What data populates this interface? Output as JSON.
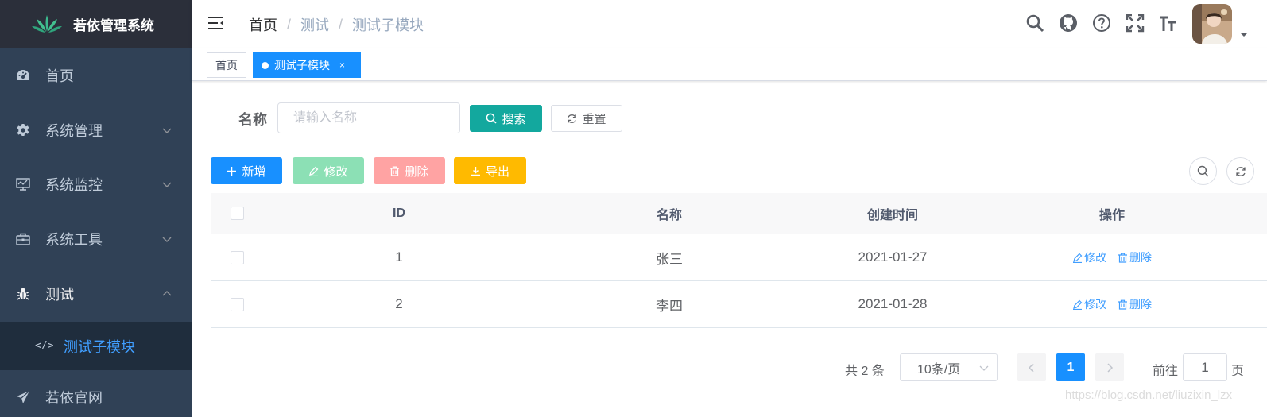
{
  "app": {
    "title": "若依管理系统"
  },
  "sidebar": {
    "items": [
      {
        "label": "首页",
        "icon": "dashboard-icon"
      },
      {
        "label": "系统管理",
        "icon": "gear-icon"
      },
      {
        "label": "系统监控",
        "icon": "monitor-icon"
      },
      {
        "label": "系统工具",
        "icon": "toolbox-icon"
      },
      {
        "label": "测试",
        "icon": "bug-icon"
      },
      {
        "label": "若依官网",
        "icon": "send-icon"
      }
    ],
    "submenu": {
      "label": "测试子模块",
      "icon": "code-icon"
    }
  },
  "breadcrumb": [
    "首页",
    "测试",
    "测试子模块"
  ],
  "tags": [
    {
      "label": "首页"
    },
    {
      "label": "测试子模块",
      "close": "×"
    }
  ],
  "search": {
    "label": "名称",
    "placeholder": "请输入名称",
    "search_btn": "搜索",
    "reset_btn": "重置"
  },
  "toolbar": {
    "add": "新增",
    "edit": "修改",
    "delete": "删除",
    "export": "导出"
  },
  "table": {
    "headers": {
      "id": "ID",
      "name": "名称",
      "time": "创建时间",
      "ops": "操作"
    },
    "rows": [
      {
        "id": "1",
        "name": "张三",
        "time": "2021-01-27",
        "edit": "修改",
        "delete": "删除"
      },
      {
        "id": "2",
        "name": "李四",
        "time": "2021-01-28",
        "edit": "修改",
        "delete": "删除"
      }
    ]
  },
  "pagination": {
    "total": "共 2 条",
    "page_size": "10条/页",
    "current": "1",
    "goto_label": "前往",
    "goto_value": "1",
    "page_suffix": "页"
  },
  "watermark": "https://blog.csdn.net/liuzixin_lzx",
  "colors": {
    "sidebar_bg": "#304156",
    "primary": "#1890ff",
    "search_btn": "#13a89e",
    "edit_btn": "#8ce0b5",
    "delete_btn": "#ffa3a3",
    "export_btn": "#ffba00"
  }
}
